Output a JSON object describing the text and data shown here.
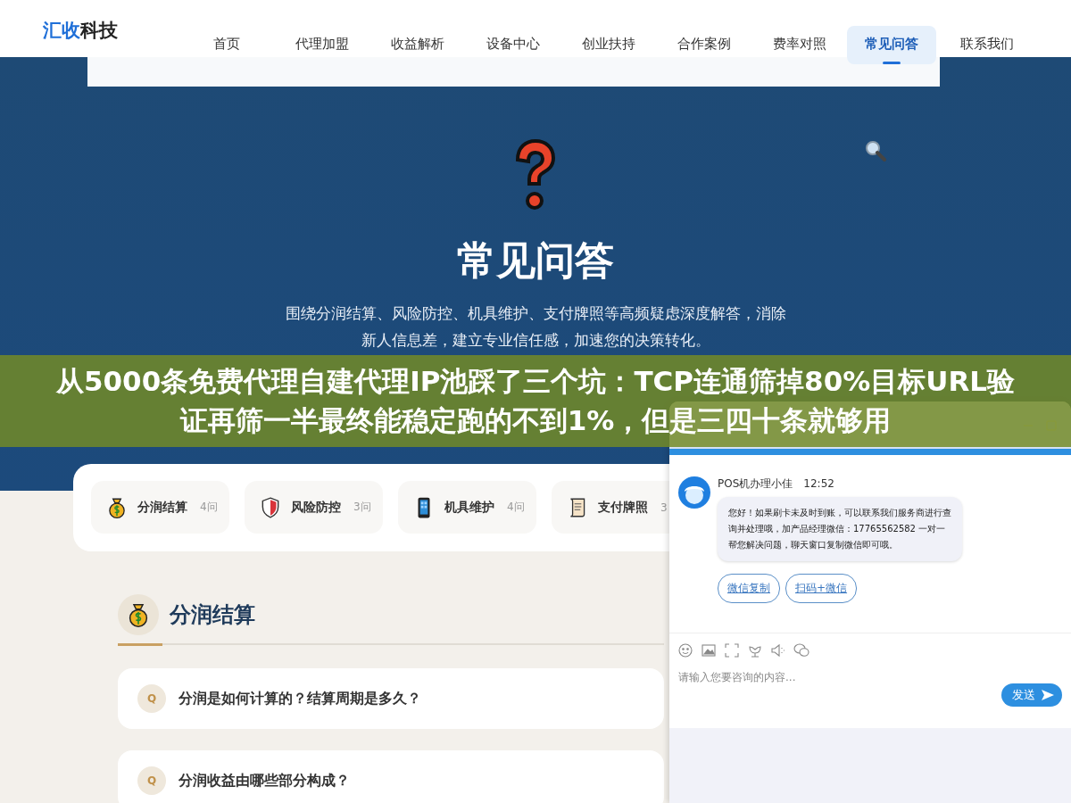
{
  "header": {
    "logo": {
      "part_1": "汇收",
      "part_2": "科技"
    },
    "nav": [
      {
        "label": "首页",
        "selected": false
      },
      {
        "label": "代理加盟",
        "selected": false
      },
      {
        "label": "收益解析",
        "selected": false
      },
      {
        "label": "设备中心",
        "selected": false
      },
      {
        "label": "创业扶持",
        "selected": false
      },
      {
        "label": "合作案例",
        "selected": false
      },
      {
        "label": "费率对照",
        "selected": false
      },
      {
        "label": "常见问答",
        "selected": true
      },
      {
        "label": "联系我们",
        "selected": false
      }
    ]
  },
  "hero": {
    "title": "常见问答",
    "subtitle": "围绕分润结算、风险防控、机具维护、支付牌照等高频疑虑深度解答，消除新人信息差，建立专业信任感，加速您的决策转化。"
  },
  "overlay_title": "从5000条免费代理自建代理IP池踩了三个坑：TCP连通筛掉80%目标URL验证再筛一半最终能稳定跑的不到1%，但是三四十条就够用",
  "categories": [
    {
      "kind": "money",
      "label": "分润结算",
      "count": "4问"
    },
    {
      "kind": "shield",
      "label": "风险防控",
      "count": "3问"
    },
    {
      "kind": "phone",
      "label": "机具维护",
      "count": "4问"
    },
    {
      "kind": "scroll",
      "label": "支付牌照",
      "count": "3"
    }
  ],
  "section": {
    "kind": "money",
    "title": "分润结算",
    "questions": [
      {
        "badge": "Q",
        "text": "分润是如何计算的？结算周期是多久？"
      },
      {
        "badge": "Q",
        "text": "分润收益由哪些部分构成？"
      }
    ]
  },
  "chat": {
    "agent": "POS机办理小佳",
    "time": "12:52",
    "message": "您好！如果刷卡未及时到账，可以联系我们服务商进行查询并处理哦，加产品经理微信：17765562582 一对一帮您解决问题，聊天窗口复制微信即可哦。",
    "actions": [
      "微信复制",
      "扫码+微信"
    ],
    "input": {
      "placeholder": "请输入您要咨询的内容..."
    },
    "send": "发送"
  }
}
